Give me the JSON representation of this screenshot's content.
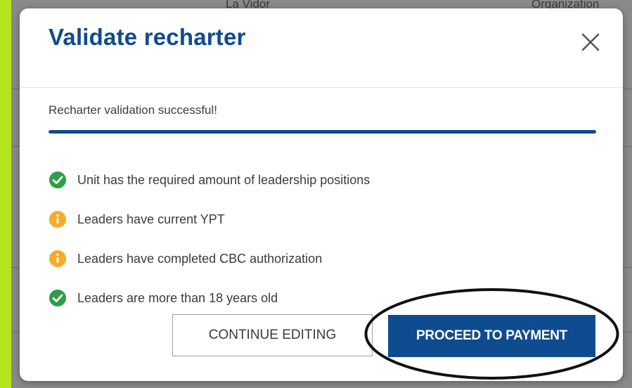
{
  "background": {
    "header_fragments": [
      "La Vidor",
      "Organization"
    ]
  },
  "modal": {
    "title": "Validate recharter",
    "close_label": "Close",
    "status_text": "Recharter validation successful!",
    "progress": 1.0,
    "checks": [
      {
        "label": "Unit has the required amount of leadership positions",
        "status": "success"
      },
      {
        "label": "Leaders have current YPT",
        "status": "warning"
      },
      {
        "label": "Leaders have completed CBC authorization",
        "status": "warning"
      },
      {
        "label": "Leaders are more than 18 years old",
        "status": "success"
      }
    ],
    "buttons": {
      "continue_label": "CONTINUE EDITING",
      "proceed_label": "PROCEED TO PAYMENT"
    }
  },
  "colors": {
    "accent": "#0f4b8f",
    "success": "#2e9e47",
    "warning": "#f5ab2b",
    "frame": "#b5e61d",
    "annotation": "#111111"
  },
  "icons": {
    "success": "check-circle-icon",
    "warning": "info-circle-icon",
    "close": "close-icon"
  }
}
